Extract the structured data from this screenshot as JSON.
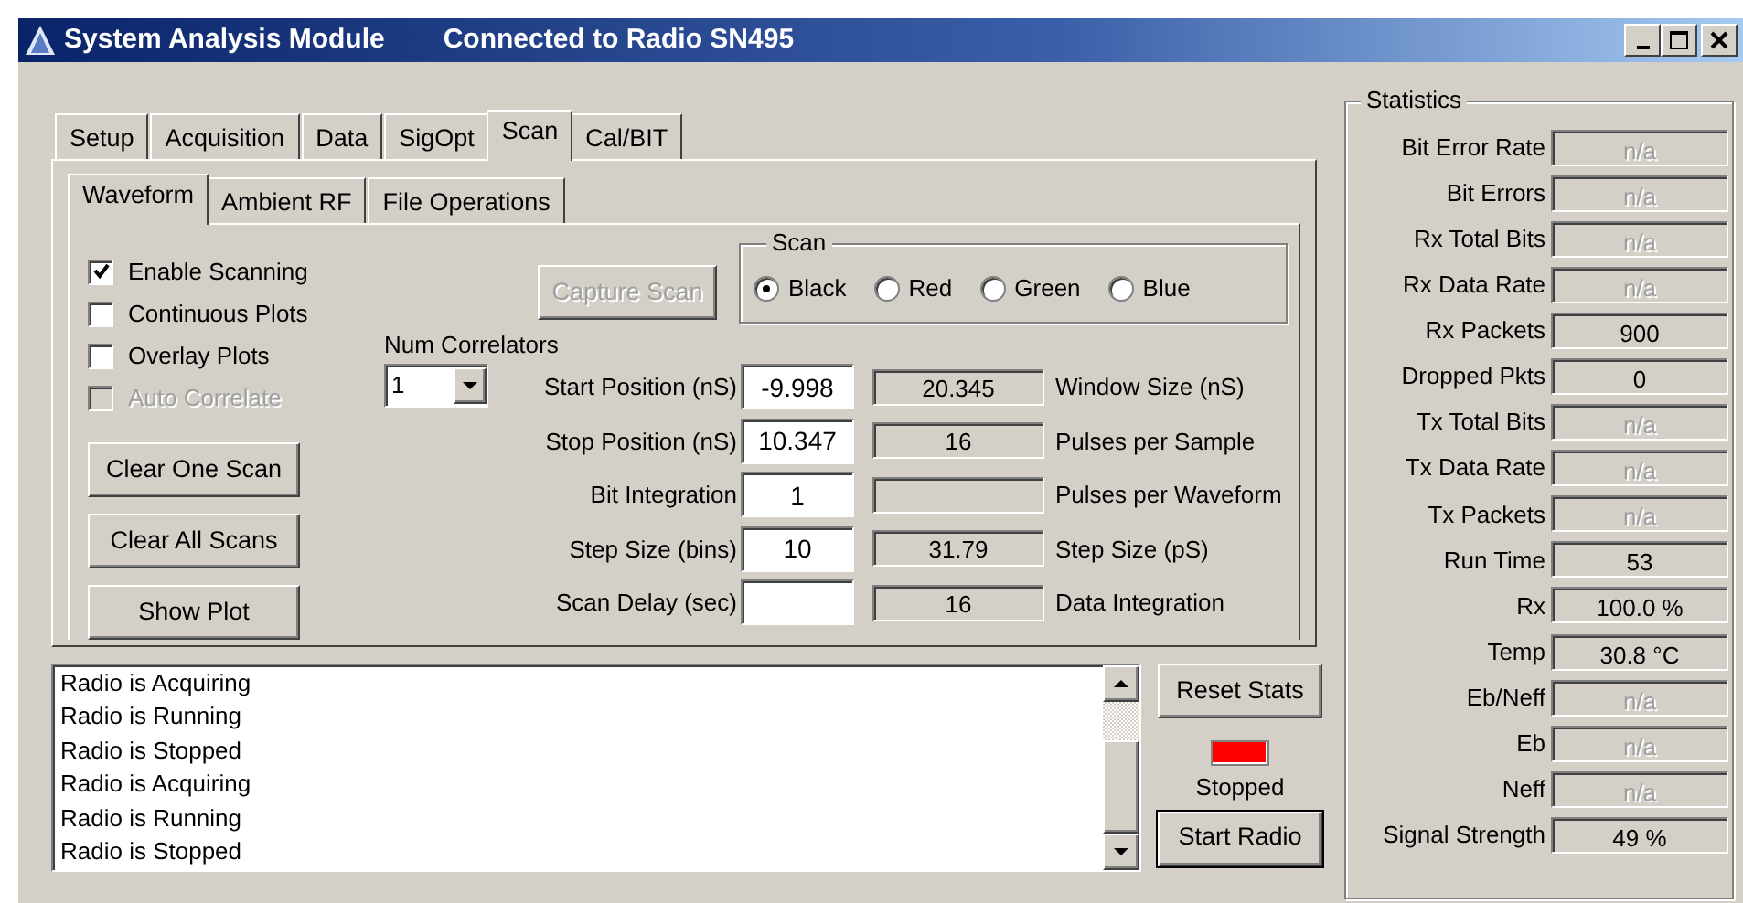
{
  "window": {
    "title": "System Analysis Module",
    "subtitle": "Connected to Radio SN495"
  },
  "tabs": [
    {
      "label": "Setup",
      "selected": false
    },
    {
      "label": "Acquisition",
      "selected": false
    },
    {
      "label": "Data",
      "selected": false
    },
    {
      "label": "SigOpt",
      "selected": false
    },
    {
      "label": "Scan",
      "selected": true
    },
    {
      "label": "Cal/BIT",
      "selected": false
    }
  ],
  "subtabs": [
    {
      "label": "Waveform",
      "selected": true
    },
    {
      "label": "Ambient RF",
      "selected": false
    },
    {
      "label": "File Operations",
      "selected": false
    }
  ],
  "checkboxes": [
    {
      "label": "Enable Scanning",
      "checked": true,
      "disabled": false
    },
    {
      "label": "Continuous Plots",
      "checked": false,
      "disabled": false
    },
    {
      "label": "Overlay Plots",
      "checked": false,
      "disabled": false
    },
    {
      "label": "Auto Correlate",
      "checked": false,
      "disabled": true
    }
  ],
  "scan_buttons": [
    {
      "label": "Clear One Scan"
    },
    {
      "label": "Clear All Scans"
    },
    {
      "label": "Show Plot"
    }
  ],
  "capture_button": {
    "label": "Capture Scan",
    "disabled": true
  },
  "scan_group": {
    "title": "Scan",
    "options": [
      {
        "label": "Black",
        "selected": true
      },
      {
        "label": "Red",
        "selected": false
      },
      {
        "label": "Green",
        "selected": false
      },
      {
        "label": "Blue",
        "selected": false
      }
    ]
  },
  "num_correlators": {
    "label": "Num Correlators",
    "value": "1"
  },
  "fields": [
    {
      "label": "Start Position (nS)",
      "value": "-9.998",
      "readout": "20.345",
      "readout_label": "Window Size (nS)"
    },
    {
      "label": "Stop Position (nS)",
      "value": "10.347",
      "readout": "16",
      "readout_label": "Pulses per Sample"
    },
    {
      "label": "Bit Integration",
      "value": "1",
      "readout_label": "Pulses per Waveform"
    },
    {
      "label": "Step Size (bins)",
      "value": "10",
      "readout": "31.79",
      "readout_label": "Step Size (pS)"
    },
    {
      "label": "Scan Delay (sec)",
      "readout": "16",
      "readout_label": "Data Integration"
    }
  ],
  "log": [
    "Radio is Acquiring",
    "Radio is Running",
    "Radio is Stopped",
    "Radio is Acquiring",
    "Radio is Running",
    "Radio is Stopped"
  ],
  "reset_button": {
    "label": "Reset Stats"
  },
  "indicator": {
    "color": "#ff0000",
    "label": "Stopped"
  },
  "start_button": {
    "label": "Start Radio",
    "default": true
  },
  "statistics": {
    "title": "Statistics",
    "rows": [
      {
        "label": "Bit Error Rate",
        "value": "n/a",
        "disabled": true
      },
      {
        "label": "Bit Errors",
        "value": "n/a",
        "disabled": true
      },
      {
        "label": "Rx Total Bits",
        "value": "n/a",
        "disabled": true
      },
      {
        "label": "Rx Data Rate",
        "value": "n/a",
        "disabled": true
      },
      {
        "label": "Rx Packets",
        "value": "900",
        "disabled": false
      },
      {
        "label": "Dropped Pkts",
        "value": "0",
        "disabled": false
      },
      {
        "label": "Tx Total Bits",
        "value": "n/a",
        "disabled": true
      },
      {
        "label": "Tx Data Rate",
        "value": "n/a",
        "disabled": true
      },
      {
        "label": "Tx Packets",
        "value": "n/a",
        "disabled": true
      },
      {
        "label": "Run Time",
        "value": "53",
        "disabled": false
      },
      {
        "label": "Rx",
        "value": "100.0 %",
        "disabled": false
      },
      {
        "label": "Temp",
        "value": "30.8 °C",
        "disabled": false
      },
      {
        "label": "Eb/Neff",
        "value": "n/a",
        "disabled": true
      },
      {
        "label": "Eb",
        "value": "n/a",
        "disabled": true
      },
      {
        "label": "Neff",
        "value": "n/a",
        "disabled": true
      },
      {
        "label": "Signal Strength",
        "value": "49 %",
        "disabled": false
      }
    ]
  }
}
